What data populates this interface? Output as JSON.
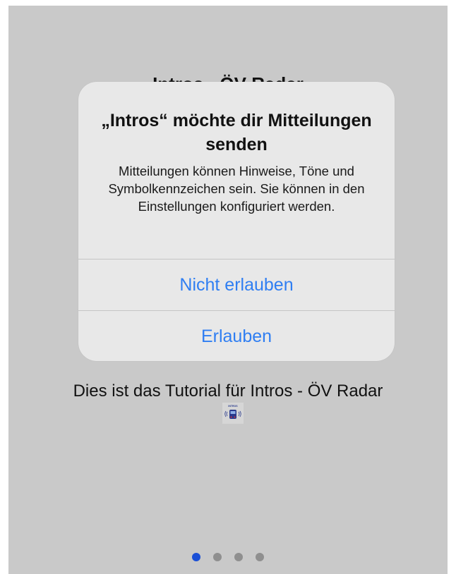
{
  "page": {
    "title": "Intros - ÖV Radar",
    "tutorial_text": "Dies ist das Tutorial für Intros - ÖV Radar",
    "logo_text": "INTROS"
  },
  "alert": {
    "title": "„Intros“ möchte dir Mitteilungen senden",
    "message": "Mitteilungen können Hinweise, Töne und Symbolkennzeichen sein. Sie können in den Einstellungen konfiguriert werden.",
    "deny_label": "Nicht erlauben",
    "allow_label": "Erlauben"
  },
  "pagination": {
    "total": 4,
    "active_index": 0
  },
  "colors": {
    "accent": "#2f7ef2",
    "dot_active": "#1a4fd6",
    "dot_inactive": "#8f8f8f",
    "background_dim": "#c9c9c9"
  }
}
